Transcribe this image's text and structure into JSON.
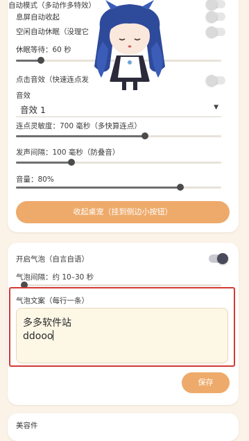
{
  "settings_card": {
    "toggles": [
      {
        "label": "自动模式（多动作多特效）",
        "on": false
      },
      {
        "label": "息屏自动收起",
        "on": false
      },
      {
        "label": "空闲自动休眠（没理它",
        "on": false
      }
    ],
    "sleep_wait_label": "休眠等待：60 秒",
    "sleep_wait_value": 0.12,
    "click_sound_label": "点击音效（快速连点发",
    "click_sound_on": false,
    "sound_label": "音效",
    "sound_select": "音效 1",
    "tap_sensitivity_label": "连点灵敏度：700 毫秒（多快算连点）",
    "tap_sensitivity_value": 0.63,
    "sound_interval_label": "发声间隔：100 毫秒（防叠音）",
    "sound_interval_value": 0.27,
    "volume_label": "音量：80%",
    "volume_value": 0.8,
    "collapse_button": "收起桌宠（挂到侧边小按钮）"
  },
  "bubble_card": {
    "enable_label": "开启气泡（自言自语）",
    "enable_on": true,
    "interval_label": "气泡间隔：约 10–30 秒",
    "interval_value": 0.0,
    "copy_label": "气泡文案（每行一条）",
    "copy_lines": [
      "多多软件站",
      "ddooo"
    ],
    "save_button": "保存"
  },
  "next_card": {
    "title": "美容件"
  },
  "colors": {
    "accent": "#eeaa6a",
    "highlight": "#d23a32",
    "background": "#fcf3e8"
  }
}
